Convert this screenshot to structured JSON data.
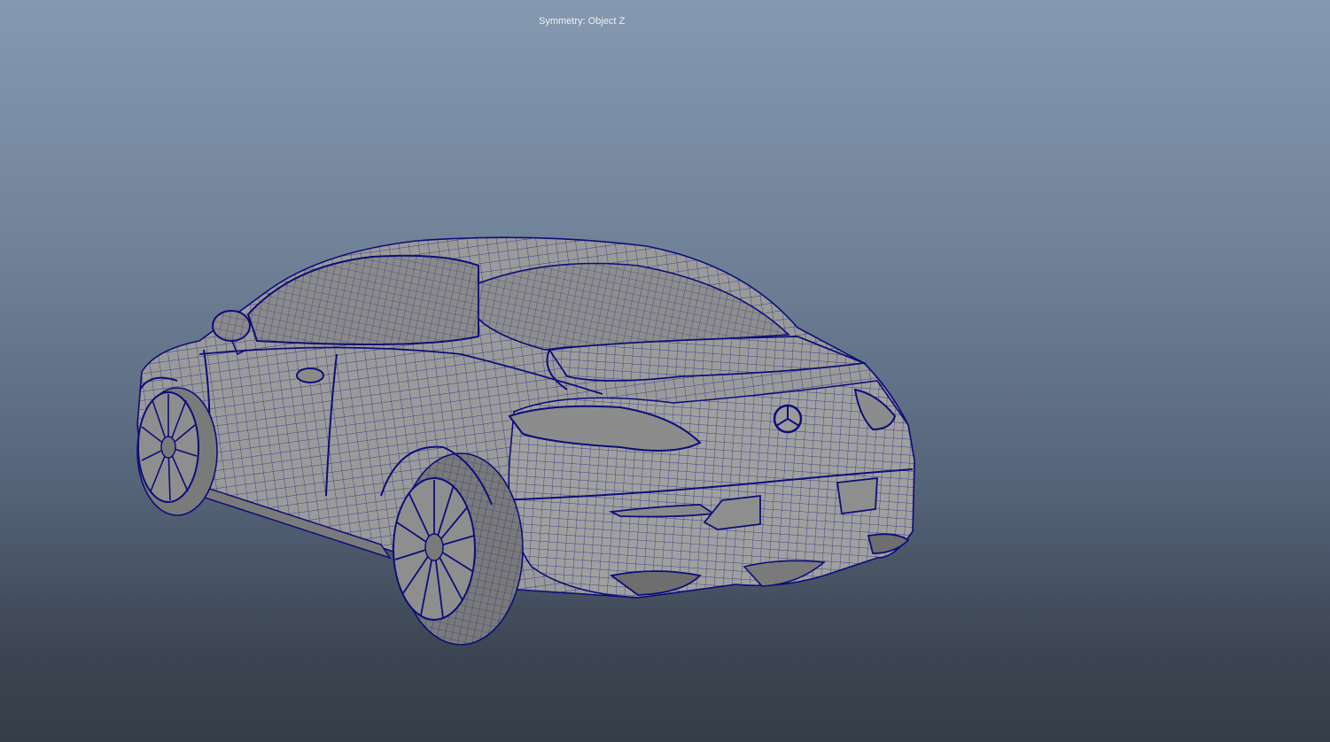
{
  "viewport": {
    "symmetry_label": "Symmetry: Object Z",
    "model_name": "car-wireframe-model",
    "wire_color": "#0d0d7a",
    "shade_color": "#9a9a9a",
    "shade_dark_color": "#7a7a7a"
  }
}
